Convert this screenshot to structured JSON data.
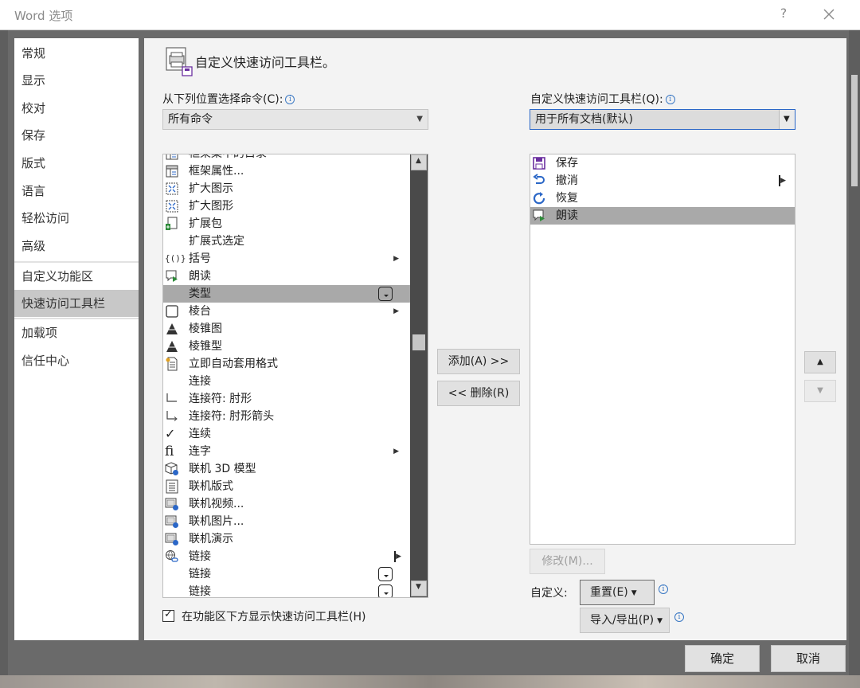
{
  "window": {
    "title": "Word 选项",
    "help": "?",
    "close_icon": "close-icon"
  },
  "nav": {
    "items": [
      "常规",
      "显示",
      "校对",
      "保存",
      "版式",
      "语言",
      "轻松访问",
      "高级",
      "自定义功能区",
      "快速访问工具栏",
      "加载项",
      "信任中心"
    ],
    "selected": "快速访问工具栏"
  },
  "main": {
    "header_title": "自定义快速访问工具栏。",
    "choose_label": "从下列位置选择命令(C):",
    "choose_value": "所有命令",
    "customize_label": "自定义快速访问工具栏(Q):",
    "customize_value": "用于所有文档(默认)",
    "commands": [
      {
        "label": "框架集中的目录",
        "icon": "frame-toc-icon"
      },
      {
        "label": "框架属性...",
        "icon": "frame-properties-icon"
      },
      {
        "label": "扩大图示",
        "icon": "expand-diagram-icon"
      },
      {
        "label": "扩大图形",
        "icon": "expand-shape-icon"
      },
      {
        "label": "扩展包",
        "icon": "expansion-pack-icon"
      },
      {
        "label": "扩展式选定",
        "icon": ""
      },
      {
        "label": "括号",
        "icon": "brackets-icon",
        "submenu": true
      },
      {
        "label": "朗读",
        "icon": "read-aloud-icon"
      },
      {
        "label": "类型",
        "icon": "",
        "dropdown": true,
        "selected": true
      },
      {
        "label": "棱台",
        "icon": "bevel-icon",
        "submenu": true
      },
      {
        "label": "棱锥图",
        "icon": "pyramid-chart-icon"
      },
      {
        "label": "棱锥型",
        "icon": "pyramid-icon"
      },
      {
        "label": "立即自动套用格式",
        "icon": "autoformat-icon"
      },
      {
        "label": "连接",
        "icon": ""
      },
      {
        "label": "连接符: 肘形",
        "icon": "elbow-connector-icon"
      },
      {
        "label": "连接符: 肘形箭头",
        "icon": "elbow-arrow-connector-icon"
      },
      {
        "label": "连续",
        "icon": "checkmark-icon"
      },
      {
        "label": "连字",
        "icon": "ligature-icon",
        "submenu": true
      },
      {
        "label": "联机 3D 模型",
        "icon": "online-3d-model-icon"
      },
      {
        "label": "联机版式",
        "icon": "online-layout-icon"
      },
      {
        "label": "联机视频...",
        "icon": "online-video-icon"
      },
      {
        "label": "联机图片...",
        "icon": "online-picture-icon"
      },
      {
        "label": "联机演示",
        "icon": "online-present-icon"
      },
      {
        "label": "链接",
        "icon": "link-icon",
        "bar_submenu": true
      },
      {
        "label": "链接",
        "icon": "",
        "dropdown": true
      },
      {
        "label": "链接",
        "icon": "",
        "dropdown": true
      }
    ],
    "toolbar_items": [
      {
        "label": "保存",
        "icon": "save-icon"
      },
      {
        "label": "撤消",
        "icon": "undo-icon",
        "bar_submenu": true
      },
      {
        "label": "恢复",
        "icon": "redo-icon"
      },
      {
        "label": "朗读",
        "icon": "read-aloud-icon",
        "selected": true
      }
    ],
    "add_button": "添加(A) >>",
    "remove_button": "<< 删除(R)",
    "modify_button": "修改(M)...",
    "customize_text": "自定义:",
    "reset_button": "重置(E)",
    "import_export_button": "导入/导出(P)",
    "show_below_checkbox": "在功能区下方显示快速访问工具栏(H)",
    "show_below_checked": true
  },
  "footer": {
    "ok": "确定",
    "cancel": "取消"
  },
  "colors": {
    "accent": "#2b67c7",
    "selection": "#a9a9a9",
    "nav_selection": "#c8c8c8",
    "dark_scroll": "#4a4a4a"
  }
}
